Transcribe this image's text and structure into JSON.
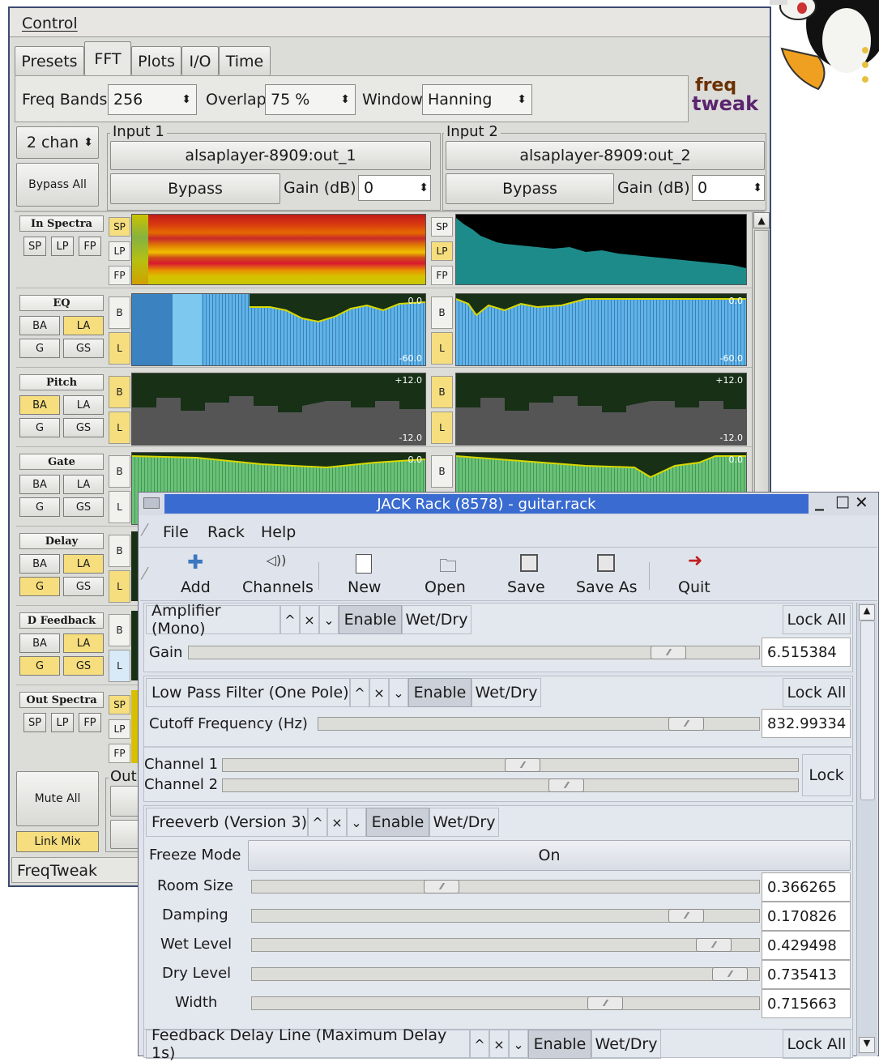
{
  "control": {
    "menu": "Control",
    "tabs": [
      "Presets",
      "FFT",
      "Plots",
      "I/O",
      "Time"
    ],
    "active_tab": "FFT",
    "freq_bands_label": "Freq Bands",
    "freq_bands": "256",
    "overlap_label": "Overlap",
    "overlap": "75 %",
    "window_label": "Window",
    "window": "Hanning",
    "logo_line1": "freq",
    "logo_line2": "tweak",
    "channels": "2 chan",
    "bypass_all": "Bypass All",
    "input1": {
      "title": "Input 1",
      "port": "alsaplayer-8909:out_1",
      "bypass": "Bypass",
      "gain_label": "Gain (dB)",
      "gain": "0"
    },
    "input2": {
      "title": "Input 2",
      "port": "alsaplayer-8909:out_2",
      "bypass": "Bypass",
      "gain_label": "Gain (dB)",
      "gain": "0"
    },
    "sections": [
      {
        "name": "In Spectra",
        "buttons": [
          "SP",
          "LP",
          "FP"
        ]
      },
      {
        "name": "EQ",
        "buttons": [
          "BA",
          "LA",
          "G",
          "GS"
        ]
      },
      {
        "name": "Pitch",
        "buttons": [
          "BA",
          "LA",
          "G",
          "GS"
        ]
      },
      {
        "name": "Gate",
        "buttons": [
          "BA",
          "LA",
          "G",
          "GS"
        ]
      },
      {
        "name": "Delay",
        "buttons": [
          "BA",
          "LA",
          "G",
          "GS"
        ]
      },
      {
        "name": "D Feedback",
        "buttons": [
          "BA",
          "LA",
          "G",
          "GS"
        ]
      },
      {
        "name": "Out Spectra",
        "buttons": [
          "SP",
          "LP",
          "FP"
        ]
      }
    ],
    "side_tags": {
      "sp": "SP",
      "lp": "LP",
      "fp": "FP",
      "b": "B",
      "l": "L"
    },
    "plot_labels": {
      "eq_top": "0.0",
      "eq_bottom": "-60.0",
      "pitch_top": "+12.0",
      "pitch_bottom": "-12.0",
      "gate_top": "0.0"
    },
    "mute_all": "Mute All",
    "link_mix": "Link Mix",
    "output_partial": "Out",
    "status": "FreqTweak"
  },
  "jack": {
    "title": "JACK Rack (8578) - guitar.rack",
    "menu": [
      "File",
      "Rack",
      "Help"
    ],
    "toolbar": [
      "Add",
      "Channels",
      "New",
      "Open",
      "Save",
      "Save As",
      "Quit"
    ],
    "plugins": [
      {
        "name": "Amplifier (Mono)",
        "enable": "Enable",
        "wetdry": "Wet/Dry",
        "lock_all": "Lock All",
        "controls": [
          {
            "label": "Gain",
            "value": "6.515384",
            "pos": 0.87
          }
        ]
      },
      {
        "name": "Low Pass Filter (One Pole)",
        "enable": "Enable",
        "wetdry": "Wet/Dry",
        "lock_all": "Lock All",
        "controls": [
          {
            "label": "Cutoff Frequency (Hz)",
            "value": "832.99334",
            "pos": 0.86
          }
        ],
        "channels": [
          {
            "label": "Channel 1",
            "pos": 0.52
          },
          {
            "label": "Channel 2",
            "pos": 0.58
          }
        ],
        "lock": "Lock"
      },
      {
        "name": "Freeverb (Version 3)",
        "enable": "Enable",
        "wetdry": "Wet/Dry",
        "freeze_label": "Freeze Mode",
        "freeze_value": "On",
        "controls": [
          {
            "label": "Room Size",
            "value": "0.366265",
            "pos": 0.37
          },
          {
            "label": "Damping",
            "value": "0.170826",
            "pos": 0.86
          },
          {
            "label": "Wet Level",
            "value": "0.429498",
            "pos": 0.92
          },
          {
            "label": "Dry Level",
            "value": "0.735413",
            "pos": 0.95
          },
          {
            "label": "Width",
            "value": "0.715663",
            "pos": 0.7
          }
        ]
      },
      {
        "name": "Feedback Delay Line (Maximum Delay 1s)",
        "enable": "Enable",
        "wetdry": "Wet/Dry",
        "lock_all": "Lock All"
      }
    ],
    "arrows": {
      "up": "^",
      "close": "×",
      "down": "⌄"
    },
    "win_controls": {
      "min": "_",
      "max": "□",
      "close": "✕"
    }
  }
}
